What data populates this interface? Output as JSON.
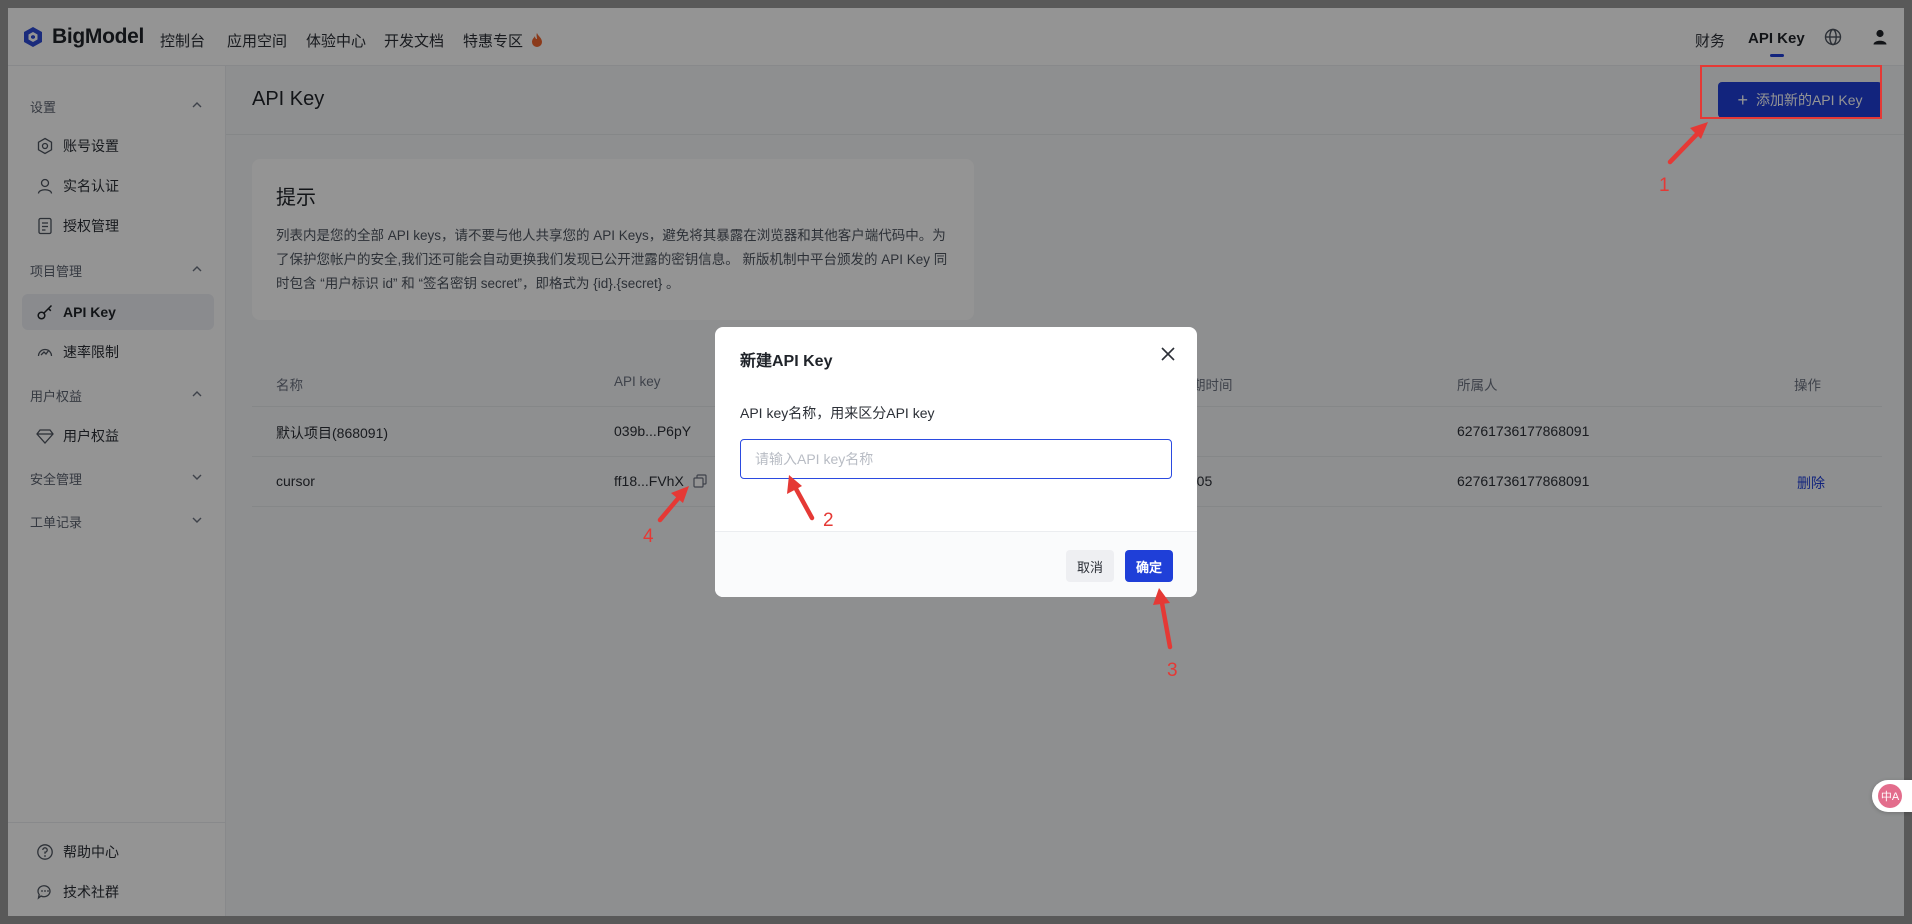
{
  "brand": {
    "name": "BigModel",
    "accent": "#1f3fd8"
  },
  "nav": {
    "links": [
      "控制台",
      "应用空间",
      "体验中心",
      "开发文档",
      "特惠专区"
    ],
    "promo_icon": "fire-icon",
    "right": {
      "finance": "财务",
      "api_key": "API Key"
    },
    "icons": [
      "globe-icon",
      "user-icon"
    ]
  },
  "sidebar": {
    "groups": [
      {
        "label": "设置",
        "expanded": true
      },
      {
        "label": "项目管理",
        "expanded": true
      },
      {
        "label": "用户权益",
        "expanded": true
      },
      {
        "label": "安全管理",
        "expanded": false
      },
      {
        "label": "工单记录",
        "expanded": false
      }
    ],
    "items": [
      {
        "label": "账号设置",
        "icon": "settings-icon"
      },
      {
        "label": "实名认证",
        "icon": "person-icon"
      },
      {
        "label": "授权管理",
        "icon": "document-icon"
      },
      {
        "label": "API Key",
        "icon": "key-icon",
        "active": true
      },
      {
        "label": "速率限制",
        "icon": "gauge-icon"
      },
      {
        "label": "用户权益",
        "icon": "diamond-icon"
      }
    ],
    "footer": [
      {
        "label": "帮助中心",
        "icon": "help-icon"
      },
      {
        "label": "技术社群",
        "icon": "chat-icon"
      }
    ]
  },
  "main": {
    "title": "API Key",
    "add_button": "添加新的API Key",
    "tip": {
      "title": "提示",
      "body": "列表内是您的全部 API keys，请不要与他人共享您的 API Keys，避免将其暴露在浏览器和其他客户端代码中。为了保护您帐户的安全,我们还可能会自动更换我们发现已公开泄露的密钥信息。 新版机制中平台颁发的 API Key 同时包含 “用户标识 id” 和 “签名密钥 secret”，即格式为 {id}.{secret} 。"
    },
    "table": {
      "headers": [
        "名称",
        "API key",
        "期时间",
        "所属人",
        "操作"
      ],
      "rows": [
        {
          "name": "默认项目(868091)",
          "key": "039b...P6pY",
          "time": "",
          "owner": "62761736177868091",
          "action": ""
        },
        {
          "name": "cursor",
          "key": "ff18...FVhX",
          "time": "-05",
          "owner": "62761736177868091",
          "action": "删除"
        }
      ]
    }
  },
  "modal": {
    "title": "新建API Key",
    "label": "API key名称，用来区分API key",
    "input_placeholder": "请输入API key名称",
    "input_value": "",
    "cancel": "取消",
    "confirm": "确定"
  },
  "annotations": {
    "color": "#e53935",
    "numbers": [
      "1",
      "2",
      "3",
      "4"
    ]
  },
  "widget": {
    "translate_glyph": "中A"
  }
}
